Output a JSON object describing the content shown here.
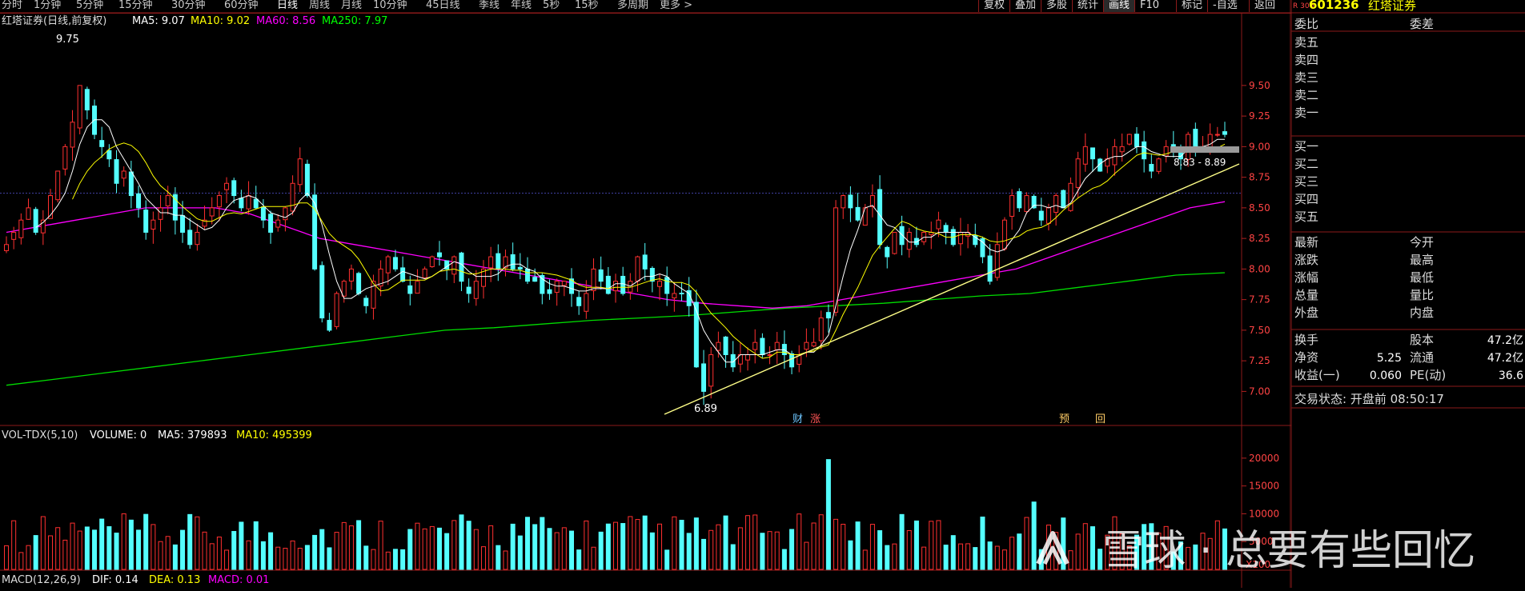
{
  "toolbar": {
    "periods": [
      "分时",
      "1分钟",
      "5分钟",
      "15分钟",
      "30分钟",
      "60分钟",
      "日线",
      "周线",
      "月线",
      "10分钟",
      "45日线",
      "季线",
      "年线",
      "5秒",
      "15秒",
      "多周期",
      "更多 >"
    ],
    "active_period": "日线",
    "right_buttons": [
      "复权",
      "叠加",
      "多股",
      "统计",
      "画线",
      "F10",
      "标记",
      "-自选",
      "返回"
    ],
    "active_right": "画线"
  },
  "stock": {
    "name": "红塔证券",
    "code": "601236",
    "tag": "R 300",
    "legend_prefix": "红塔证券(日线,前复权)",
    "ma": [
      {
        "label": "MA5: 9.07",
        "color": "#ffffff"
      },
      {
        "label": "MA10: 9.02",
        "color": "#ffff00"
      },
      {
        "label": "MA60: 8.56",
        "color": "#ff00ff"
      },
      {
        "label": "MA250: 7.97",
        "color": "#00ff00"
      }
    ]
  },
  "price_labels": {
    "high": "9.75",
    "low": "6.89",
    "range": "8.83 - 8.89",
    "markers": [
      "财",
      "涨",
      "预",
      "回"
    ]
  },
  "volume_legend": {
    "title": "VOL-TDX(5,10)",
    "volume": "VOLUME: 0",
    "ma5": "MA5: 379893",
    "ma10": "MA10: 495399"
  },
  "macd_legend": {
    "title": "MACD(12,26,9)",
    "dif": "DIF: 0.14",
    "dea": "DEA: 0.13",
    "macd": "MACD: 0.01"
  },
  "chart_data": {
    "type": "candlestick",
    "title": "红塔证券(日线,前复权)",
    "price_axis": {
      "ticks": [
        "9.50",
        "9.25",
        "9.00",
        "8.75",
        "8.50",
        "8.25",
        "8.00",
        "7.75",
        "7.50",
        "7.25",
        "7.00"
      ],
      "ylim": [
        6.8,
        9.95
      ]
    },
    "volume_axis": {
      "ticks": [
        "20000",
        "15000",
        "10000",
        "5000"
      ],
      "ylim": [
        0,
        23000
      ],
      "unit": "X100"
    },
    "reference_line": 8.62,
    "close": [
      8.2,
      8.3,
      8.4,
      8.5,
      8.3,
      8.4,
      8.6,
      8.8,
      9.0,
      9.2,
      9.5,
      9.3,
      9.1,
      9.0,
      8.9,
      8.7,
      8.8,
      8.6,
      8.5,
      8.3,
      8.4,
      8.5,
      8.6,
      8.4,
      8.3,
      8.2,
      8.3,
      8.4,
      8.5,
      8.6,
      8.7,
      8.6,
      8.5,
      8.6,
      8.5,
      8.4,
      8.3,
      8.4,
      8.5,
      8.7,
      8.9,
      8.6,
      8.0,
      7.6,
      7.5,
      7.8,
      7.9,
      8.0,
      7.8,
      7.7,
      7.9,
      8.0,
      8.1,
      8.0,
      7.9,
      7.8,
      7.9,
      8.0,
      8.1,
      8.1,
      8.0,
      8.1,
      7.9,
      7.8,
      7.9,
      8.0,
      8.1,
      8.0,
      8.1,
      8.0,
      8.0,
      7.9,
      7.9,
      7.8,
      7.8,
      7.9,
      7.9,
      7.8,
      7.7,
      7.8,
      8.0,
      7.9,
      7.8,
      7.9,
      7.8,
      7.9,
      8.1,
      8.0,
      7.9,
      7.9,
      7.8,
      7.8,
      7.8,
      7.7,
      7.2,
      7.0,
      7.3,
      7.4,
      7.3,
      7.2,
      7.3,
      7.3,
      7.4,
      7.3,
      7.3,
      7.4,
      7.3,
      7.2,
      7.3,
      7.4,
      7.4,
      7.6,
      7.6,
      8.5,
      8.6,
      8.5,
      8.4,
      8.5,
      8.6,
      8.2,
      8.1,
      8.3,
      8.2,
      8.3,
      8.2,
      8.3,
      8.3,
      8.4,
      8.3,
      8.2,
      8.3,
      8.3,
      8.2,
      8.1,
      7.9,
      8.2,
      8.4,
      8.6,
      8.5,
      8.6,
      8.5,
      8.4,
      8.5,
      8.6,
      8.5,
      8.7,
      8.9,
      9.0,
      8.9,
      8.8,
      8.9,
      9.0,
      9.0,
      9.1,
      9.0,
      8.9,
      8.8,
      8.9,
      9.0,
      9.0,
      8.9,
      9.1,
      9.0,
      9.0,
      9.1,
      9.1,
      9.1
    ],
    "ma60": [
      8.3,
      8.35,
      8.4,
      8.45,
      8.5,
      8.5,
      8.5,
      8.45,
      8.35,
      8.25,
      8.2,
      8.15,
      8.1,
      8.05,
      8.0,
      7.95,
      7.9,
      7.85,
      7.8,
      7.75,
      7.72,
      7.7,
      7.68,
      7.7,
      7.75,
      7.8,
      7.85,
      7.9,
      7.95,
      8.0,
      8.1,
      8.2,
      8.3,
      8.4,
      8.5,
      8.55
    ],
    "ma250": [
      7.05,
      7.1,
      7.15,
      7.2,
      7.25,
      7.3,
      7.35,
      7.4,
      7.45,
      7.5,
      7.52,
      7.55,
      7.58,
      7.6,
      7.62,
      7.65,
      7.68,
      7.7,
      7.72,
      7.75,
      7.78,
      7.8,
      7.85,
      7.9,
      7.95,
      7.97
    ]
  }
}
